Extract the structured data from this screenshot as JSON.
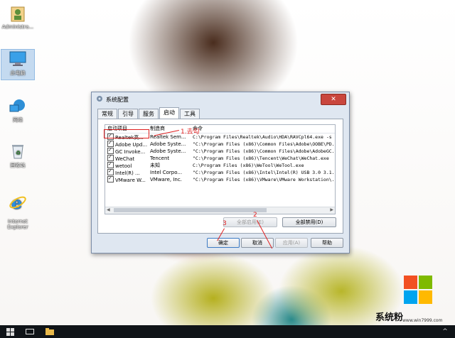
{
  "desktop": {
    "icons": [
      {
        "label": "Administra..."
      },
      {
        "label": "此电脑"
      },
      {
        "label": "网络"
      },
      {
        "label": "回收站"
      },
      {
        "label": "Internet\nExplorer"
      }
    ]
  },
  "dialog": {
    "title": "系统配置",
    "close_label": "✕",
    "tabs": [
      "常规",
      "引导",
      "服务",
      "启动",
      "工具"
    ],
    "active_tab": "启动",
    "columns": [
      "启动项目",
      "制造商",
      "命令"
    ],
    "rows": [
      {
        "item": "Realtek高...",
        "maker": "Realtek Sem...",
        "command": "C:\\Program Files\\Realtek\\Audio\\HDA\\RAVCpl64.exe -s"
      },
      {
        "item": "Adobe Upd...",
        "maker": "Adobe Syste...",
        "command": "\"C:\\Program Files (x86)\\Common Files\\Adobe\\OOBE\\PD..."
      },
      {
        "item": "GC Invoke...",
        "maker": "Adobe Syste...",
        "command": "\"C:\\Program Files (x86)\\Common Files\\Adobe\\AdobeGC..."
      },
      {
        "item": "WeChat",
        "maker": "Tencent",
        "command": "\"C:\\Program Files (x86)\\Tencent\\WeChat\\WeChat.exe"
      },
      {
        "item": "wetool",
        "maker": "未知",
        "command": "C:\\Program Files (x86)\\WeTool\\WeTool.exe"
      },
      {
        "item": "Intel(R) ...",
        "maker": "Intel Corpo...",
        "command": "\"C:\\Program Files (x86)\\Intel\\Intel(R) USB 3.0 3.1..."
      },
      {
        "item": "VMware W...",
        "maker": "VMware, Inc.",
        "command": "\"C:\\Program Files (x86)\\VMware\\VMware Workstation\\..."
      }
    ],
    "buttons": {
      "enable_all": "全部启用(E)",
      "disable_all": "全部禁用(D)",
      "ok": "确定",
      "cancel": "取消",
      "apply": "应用(A)",
      "help": "帮助"
    }
  },
  "annotations": {
    "step1": "1.去勾",
    "step2": "2",
    "step3": "3"
  },
  "watermark": {
    "site": "系统粉",
    "url": "www.win7999.com"
  },
  "colors": {
    "annotation": "#e02020",
    "close_button": "#c9463d"
  }
}
